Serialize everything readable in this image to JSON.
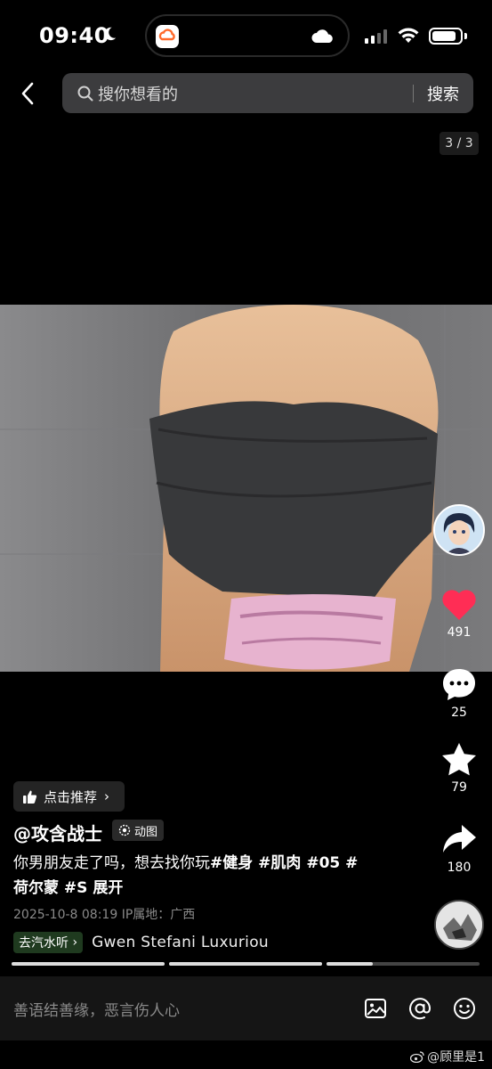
{
  "status_bar": {
    "time": "09:40",
    "battery_level": 0.85
  },
  "header": {
    "search_placeholder": "搜你想看的",
    "search_button": "搜索"
  },
  "image_counter": "3 / 3",
  "actions": {
    "likes": "491",
    "comments": "25",
    "favorites": "79",
    "shares": "180"
  },
  "post": {
    "recommend_label": "点击推荐",
    "author": "@攻含战士",
    "media_badge": "动图",
    "caption_text": "你男朋友走了吗，想去找你玩",
    "caption_tags_line1": "#健身 #肌肉 #05 #",
    "caption_tags_line2": "荷尔蒙 #S",
    "expand_label": "展开",
    "meta": "2025-10-8 08:19  IP属地：广西",
    "music_chip": "去汽水听",
    "music_title": "Gwen Stefani    Luxuriou"
  },
  "progress_segments": [
    1,
    1,
    0.3
  ],
  "comment_bar": {
    "placeholder": "善语结善缘，恶言伤人心"
  },
  "watermark": "@顾里是1",
  "colors": {
    "like_red": "#ff2d55",
    "search_bg": "#3c3c3e",
    "comment_bar_bg": "#151515"
  },
  "icons": [
    "back-arrow-icon",
    "search-icon",
    "heart-icon",
    "comment-icon",
    "star-icon",
    "share-icon",
    "image-icon",
    "at-icon",
    "emoji-icon",
    "thumb-up-icon",
    "weibo-icon"
  ]
}
